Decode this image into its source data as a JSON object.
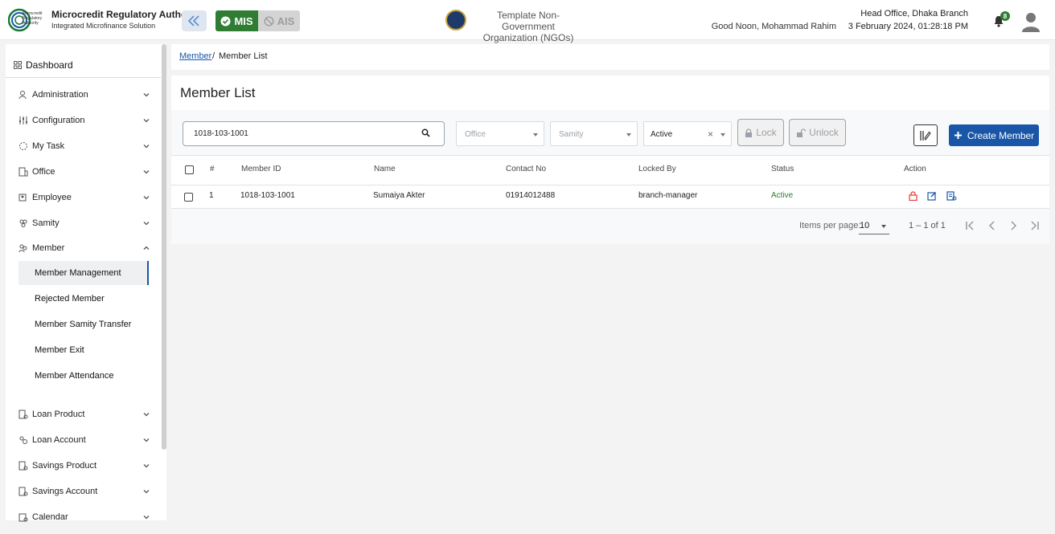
{
  "header": {
    "org_name": "Microcredit Regulatory Authority",
    "org_subtitle": "Integrated Microfinance Solution",
    "logo_text": [
      "Microcredit",
      "Regulatory",
      "Authority"
    ],
    "mode_mis": "MIS",
    "mode_ais": "AIS",
    "template_line1": "Template Non-Government",
    "template_line2": "Organization (NGOs)",
    "greeting": "Good Noon, Mohammad Rahim",
    "branch": "Head Office, Dhaka Branch",
    "datetime": "3 February 2024, 01:28:18 PM",
    "notification_count": "8",
    "colors": {
      "brand_green": "#2e7d32",
      "brand_blue": "#1a56a8"
    }
  },
  "sidebar": {
    "dashboard": "Dashboard",
    "items": [
      {
        "label": "Administration",
        "icon": "admin-icon"
      },
      {
        "label": "Configuration",
        "icon": "config-icon"
      },
      {
        "label": "My Task",
        "icon": "task-icon"
      },
      {
        "label": "Office",
        "icon": "office-icon"
      },
      {
        "label": "Employee",
        "icon": "employee-icon"
      },
      {
        "label": "Samity",
        "icon": "samity-icon"
      },
      {
        "label": "Member",
        "icon": "member-icon"
      }
    ],
    "member_sub": [
      "Member Management",
      "Rejected Member",
      "Member Samity Transfer",
      "Member Exit",
      "Member Attendance"
    ],
    "lower_items": [
      {
        "label": "Loan Product",
        "icon": "loan-product-icon"
      },
      {
        "label": "Loan Account",
        "icon": "loan-account-icon"
      },
      {
        "label": "Savings Product",
        "icon": "savings-product-icon"
      },
      {
        "label": "Savings Account",
        "icon": "savings-account-icon"
      },
      {
        "label": "Calendar",
        "icon": "calendar-icon"
      }
    ]
  },
  "breadcrumb": {
    "parent": "Member",
    "separator": "/",
    "current": "Member List"
  },
  "page": {
    "title": "Member List"
  },
  "filters": {
    "search_value": "1018-103-1001",
    "office_placeholder": "Office",
    "samity_placeholder": "Samity",
    "status_value": "Active",
    "lock_label": "Lock",
    "unlock_label": "Unlock",
    "create_label": "Create Member"
  },
  "table": {
    "columns": [
      "#",
      "Member ID",
      "Name",
      "Contact No",
      "Locked By",
      "Status",
      "Action"
    ],
    "rows": [
      {
        "no": "1",
        "member_id": "1018-103-1001",
        "name": "Sumaiya Akter",
        "contact": "01914012488",
        "locked_by": "branch-manager",
        "status": "Active"
      }
    ]
  },
  "paginator": {
    "items_per_page_label": "Items per page:",
    "items_per_page": "10",
    "range": "1 – 1 of 1"
  }
}
